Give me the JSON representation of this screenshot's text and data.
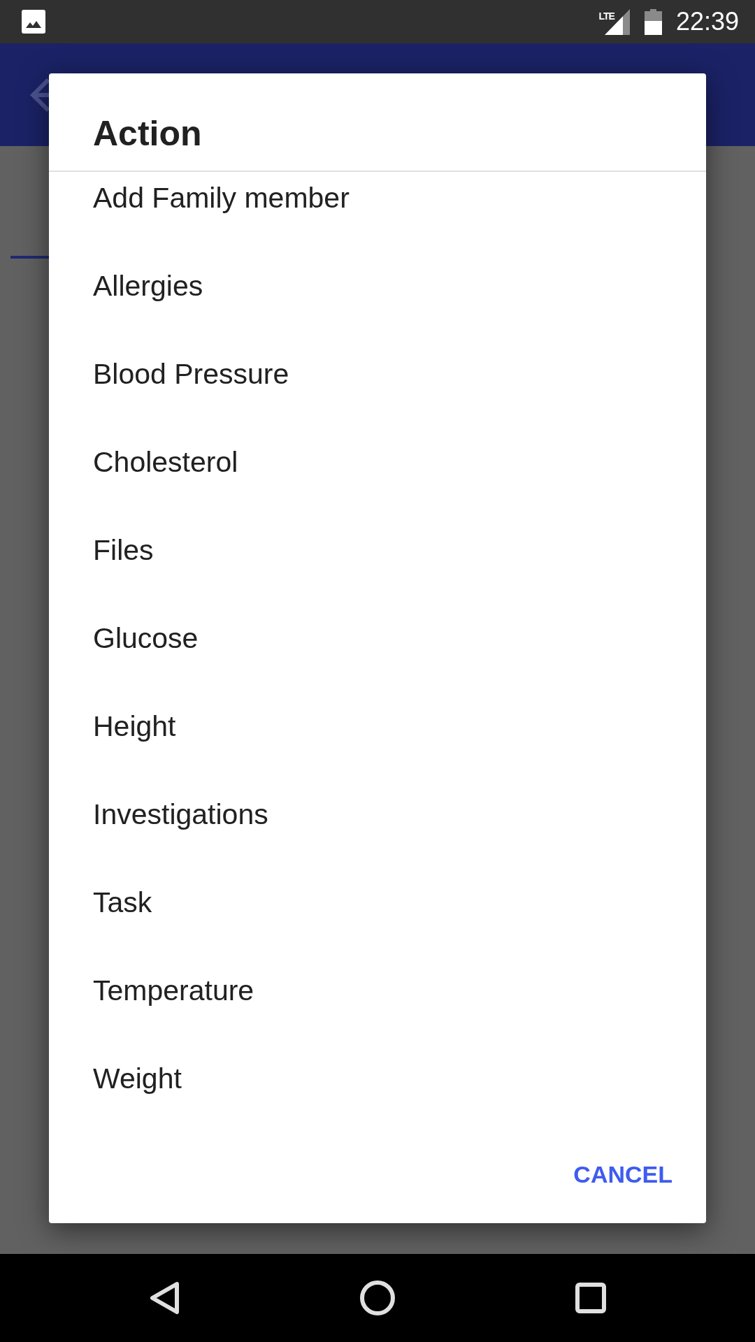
{
  "status_bar": {
    "network_type": "LTE",
    "time": "22:39"
  },
  "dialog": {
    "title": "Action",
    "items": [
      "Add Family member",
      "Allergies",
      "Blood Pressure",
      "Cholesterol",
      "Files",
      "Glucose",
      "Height",
      "Investigations",
      "Task",
      "Temperature",
      "Weight"
    ],
    "buttons": [
      "CANCEL"
    ]
  }
}
